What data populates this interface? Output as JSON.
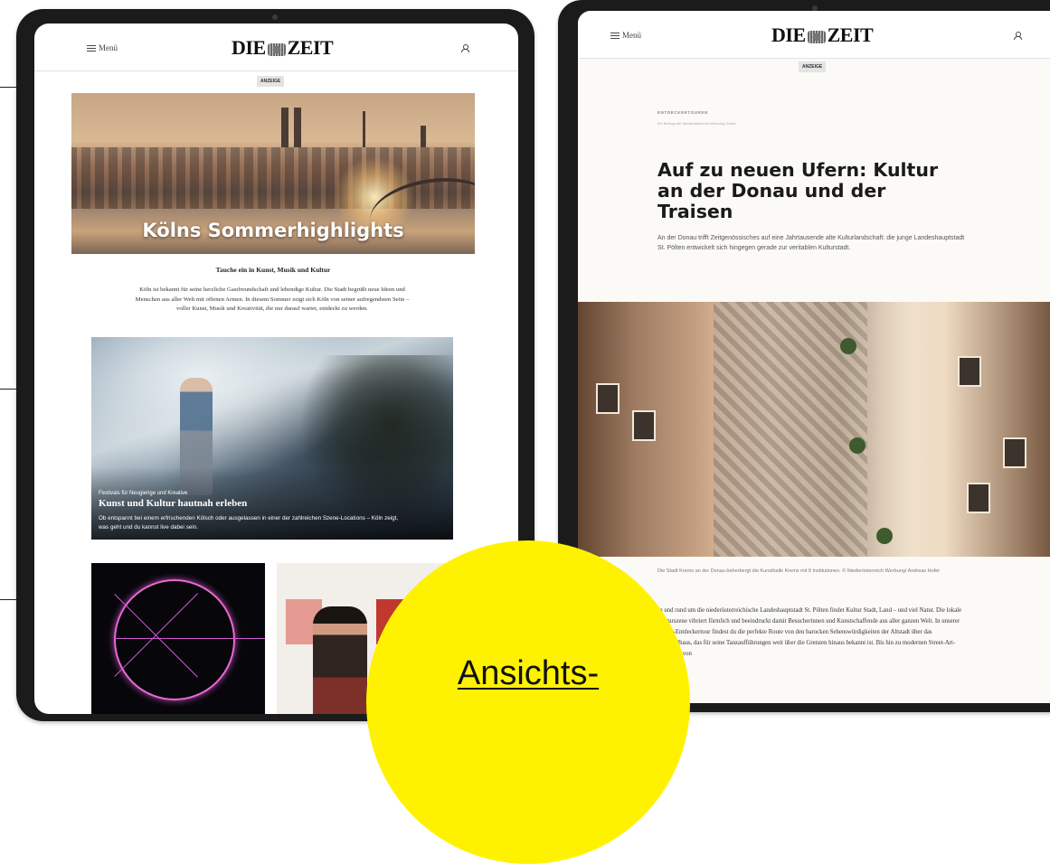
{
  "left_tablet": {
    "menu_label": "Menü",
    "logo_text_left": "DIE",
    "logo_text_right": "ZEIT",
    "ad_label": "ANZEIGE",
    "hero_title": "Kölns Sommerhighlights",
    "sub_heading": "Tauche ein in Kunst, Musik und Kultur",
    "intro_text": "Köln ist bekannt für seine herzliche Gastfreundschaft und lebendige Kultur. Die Stadt begrüßt neue Ideen und Menschen aus aller Welt mit offenen Armen. In diesem Sommer zeigt sich Köln von seiner aufregendsten Seite – voller Kunst, Musik und Kreativität, die nur darauf wartet, entdeckt zu werden.",
    "feature": {
      "kicker": "Festivals für Neugierige und Kreative",
      "title": "Kunst und Kultur hautnah erleben",
      "description": "Ob entspannt bei einem erfrischenden Kölsch oder ausgelassen in einer der zahlreichen Szene-Locations – Köln zeigt, was geht und du kannst live dabei sein."
    }
  },
  "right_tablet": {
    "menu_label": "Menü",
    "logo_text_left": "DIE",
    "logo_text_right": "ZEIT",
    "ad_label": "ANZEIGE",
    "kicker": "ENTDECKERTOUREN",
    "kicker_sub": "Ein Beitrag der Niederösterreich-Werbung GmbH",
    "title": "Auf zu neuen Ufern: Kultur an der Donau und der Traisen",
    "lede": "An der Donau trifft Zeitgenössisches auf eine Jahrtausende alte Kulturlandschaft: die junge Landeshauptstadt St. Pölten entwickelt sich hingegen gerade zur veritablen Kulturstadt.",
    "caption": "Die Stadt Krems an der Donau beherbergt die Kunsthalle Krems mit 8 Institutionen. © Niederösterreich Werbung/ Andreas Hofer",
    "body": "In und rund um die niederösterreichische Landeshauptstadt St. Pölten findet Kultur Stadt, Land – und viel Natur. Die lokale Kulturszene vibriert förmlich und beeindruckt damit Besucherinnen und Kunstschaffende aus aller ganzen Welt. In unserer Kultur-Entdeckertour findest du die perfekte Route von den barocken Sehenswürdigkeiten der Altstadt über das Festspielhaus, das für seine Tanzaufführungen weit über die Grenzen hinaus bekannt ist. Bis hin zu modernen Street-Art-Projekten von"
  },
  "overlay": {
    "link_label": "Ansichts-",
    "color": "#fff200"
  }
}
